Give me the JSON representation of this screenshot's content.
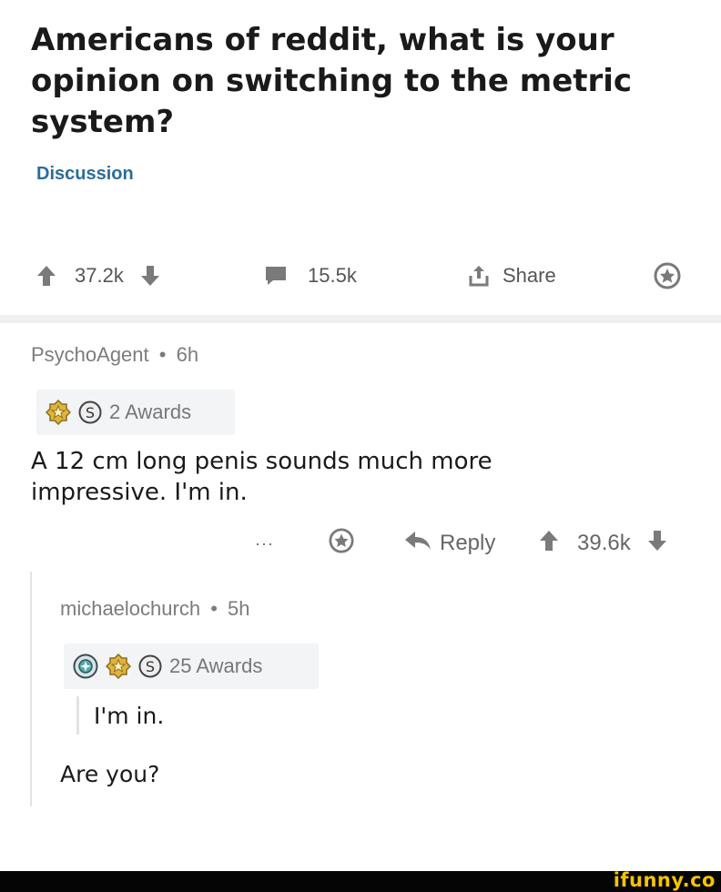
{
  "post": {
    "title": "Americans of reddit, what is your opinion on switching to the metric system?",
    "flair": "Discussion",
    "votes": "37.2k",
    "comments": "15.5k",
    "share_label": "Share"
  },
  "comments": [
    {
      "author": "PsychoAgent",
      "separator": "•",
      "age": "6h",
      "awards_label": "2 Awards",
      "body": "A 12 cm long penis sounds much more impressive. I'm in.",
      "more_label": "···",
      "reply_label": "Reply",
      "votes": "39.6k"
    },
    {
      "author": "michaelochurch",
      "separator": "•",
      "age": "5h",
      "awards_label": "25 Awards",
      "quote": "I'm in.",
      "body": "Are you?"
    }
  ],
  "watermark": "ifunny.co",
  "colors": {
    "flair": "#2b6d99",
    "meta": "#7c7c7c",
    "award_gold": "#d8a526",
    "watermark": "#f5c400"
  },
  "icons": [
    "upvote-icon",
    "downvote-icon",
    "comment-icon",
    "share-icon",
    "award-icon",
    "reply-icon",
    "silver-award-icon",
    "gold-award-icon",
    "platinum-award-icon"
  ]
}
